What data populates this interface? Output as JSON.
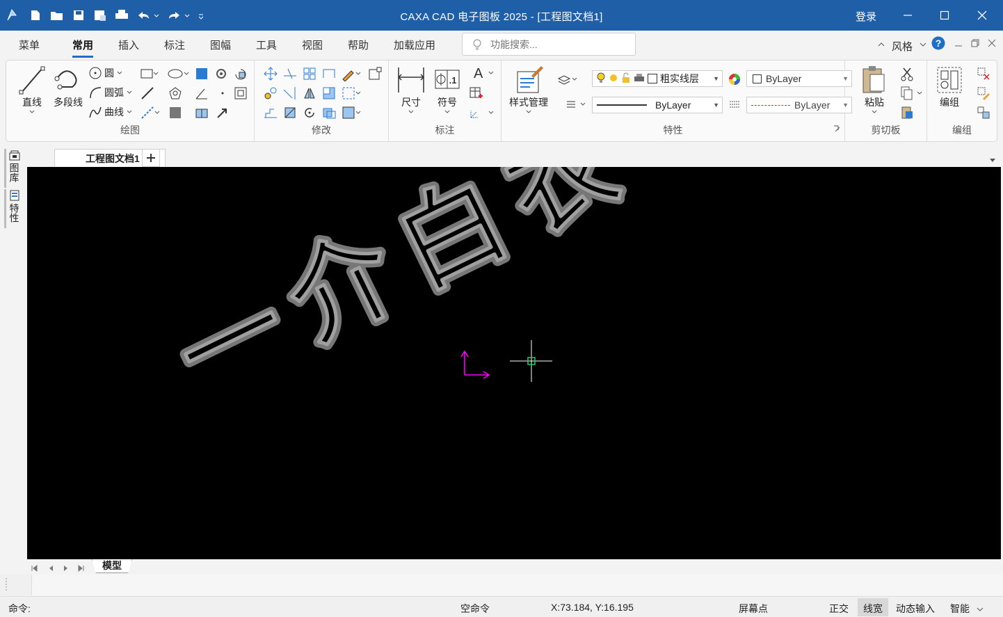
{
  "titlebar": {
    "title": "CAXA CAD 电子图板 2025 - [工程图文档1]",
    "login": "登录"
  },
  "menu": {
    "tabs": [
      "菜单",
      "常用",
      "插入",
      "标注",
      "图幅",
      "工具",
      "视图",
      "帮助",
      "加载应用"
    ],
    "active": "常用",
    "style_label": "风格"
  },
  "search": {
    "placeholder": "功能搜索..."
  },
  "ribbon": {
    "draw": {
      "label": "绘图",
      "line": "直线",
      "polyline": "多段线",
      "circle": "圆",
      "arc": "圆弧",
      "curve": "曲线"
    },
    "modify": {
      "label": "修改"
    },
    "annotate": {
      "label": "标注",
      "dimension": "尺寸",
      "symbol": "符号"
    },
    "properties": {
      "label": "特性",
      "style_manager": "样式管理",
      "layer_name": "粗实线层",
      "color": "ByLayer",
      "linetype": "ByLayer",
      "linewidth": "ByLayer"
    },
    "clipboard": {
      "label": "剪切板",
      "paste": "粘贴"
    },
    "group": {
      "label": "编组",
      "group": "编组"
    }
  },
  "doctab": {
    "name": "工程图文档1"
  },
  "sidepanel": {
    "library": "图库",
    "properties": "特性"
  },
  "canvas": {
    "watermark": "一介白衣专用"
  },
  "model": {
    "tab": "模型"
  },
  "status": {
    "command_prompt": "命令:",
    "idle": "空命令",
    "coords": "X:73.184, Y:16.195",
    "snap_mode": "屏幕点",
    "ortho": "正交",
    "linewidth": "线宽",
    "dynamic_input": "动态输入",
    "smart": "智能"
  },
  "colors": {
    "titlebar": "#1f5fa8",
    "accent": "#1f6fc5",
    "canvas": "#000000",
    "ucs": "#ff00ff",
    "cursor_box": "#22cc66"
  }
}
